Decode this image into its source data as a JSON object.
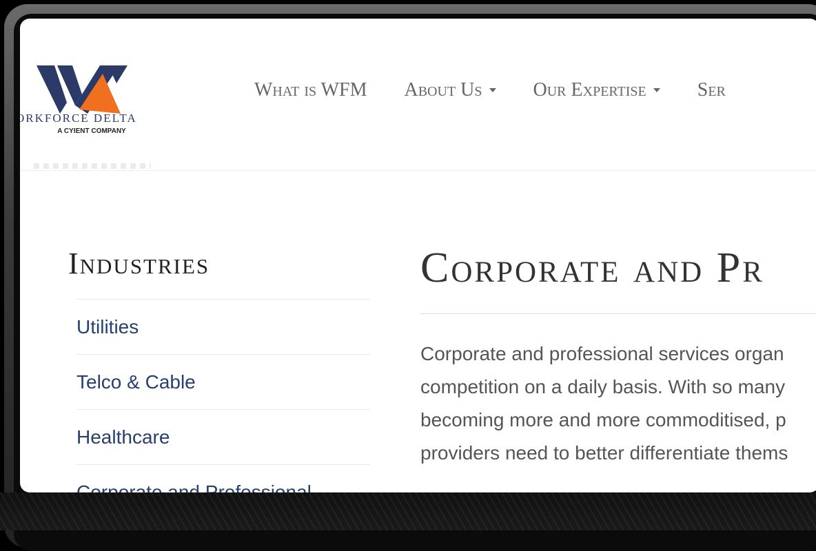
{
  "logo": {
    "name": "ORKFORCE DELTA",
    "tagline": "A CYIENT COMPANY",
    "colors": {
      "navy": "#2b3a67",
      "orange": "#f0701f"
    }
  },
  "nav": {
    "items": [
      {
        "label": "What is WFM",
        "has_dropdown": false
      },
      {
        "label": "About Us",
        "has_dropdown": true
      },
      {
        "label": "Our Expertise",
        "has_dropdown": true
      },
      {
        "label": "Ser",
        "has_dropdown": false
      }
    ]
  },
  "sidebar": {
    "title": "Industries",
    "items": [
      {
        "label": "Utilities"
      },
      {
        "label": "Telco & Cable"
      },
      {
        "label": "Healthcare"
      },
      {
        "label": "Corporate and Professional"
      }
    ]
  },
  "main": {
    "title": "Corporate and Pr",
    "paragraph_lines": [
      "Corporate and professional services organ",
      "competition on a daily basis. With so many",
      "becoming more and more commoditised, p",
      "providers need to better differentiate thems"
    ]
  }
}
